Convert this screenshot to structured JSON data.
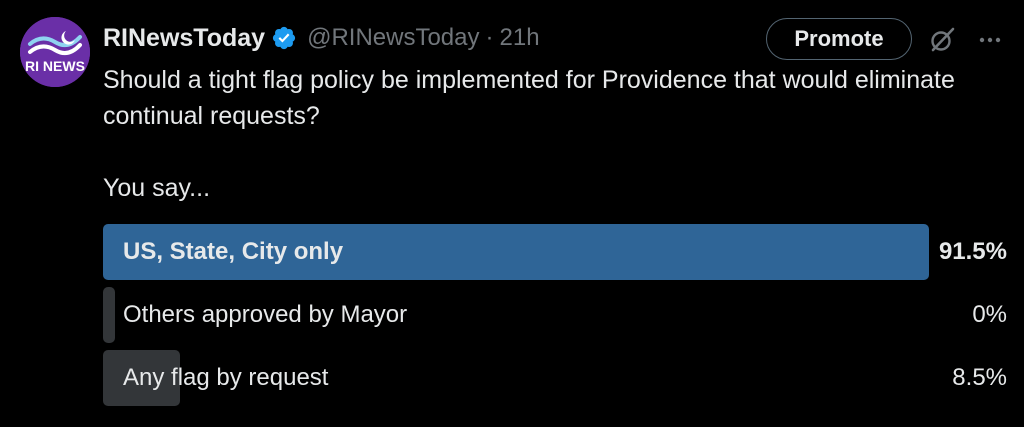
{
  "account": {
    "name": "RINewsToday",
    "handle": "@RINewsToday",
    "separator": "·",
    "time": "21h",
    "verified": true,
    "avatar_text": "RI NEWS",
    "avatar_color": "#6a2fa7",
    "verified_color": "#1d9bf0"
  },
  "actions": {
    "promote_label": "Promote",
    "grok_icon": "grok-icon",
    "more_icon": "more-options-icon"
  },
  "tweet": {
    "line1": "Should a tight flag policy be implemented for Providence that would eliminate continual requests?",
    "line2": "You say..."
  },
  "poll": {
    "winner_color": "#2f6597",
    "bar_color": "#333639",
    "options": [
      {
        "label": "US, State, City only",
        "percent_text": "91.5%",
        "percent": 91.5,
        "winner": true
      },
      {
        "label": "Others approved by Mayor",
        "percent_text": "0%",
        "percent": 0,
        "winner": false
      },
      {
        "label": "Any flag by request",
        "percent_text": "8.5%",
        "percent": 8.5,
        "winner": false
      }
    ]
  }
}
